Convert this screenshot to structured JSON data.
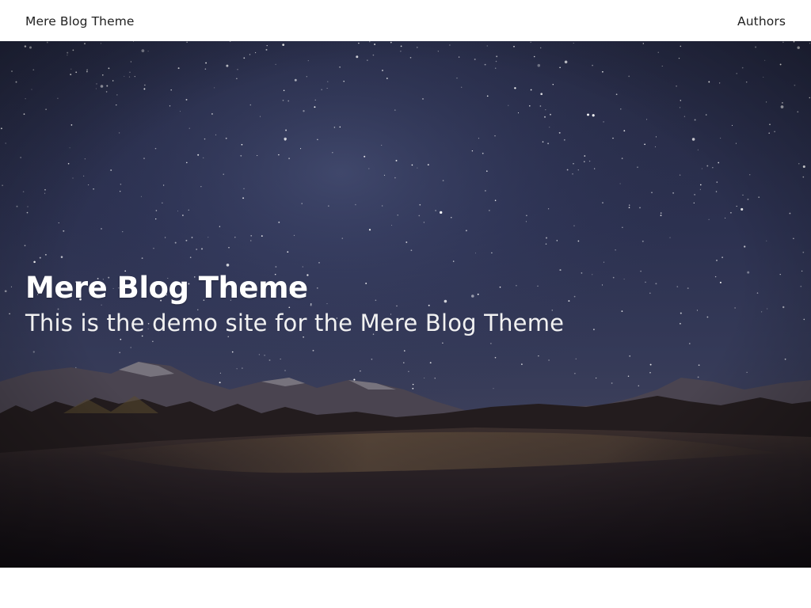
{
  "nav": {
    "site_title": "Mere Blog Theme",
    "authors_link": "Authors"
  },
  "hero": {
    "title": "Mere Blog Theme",
    "subtitle": "This is the demo site for the Mere Blog Theme",
    "image": "starry-night-mountains-photo"
  },
  "colors": {
    "nav_background": "#ffffff",
    "nav_text": "#222222",
    "hero_text": "#ffffff",
    "sky_top": "#2a2f4a",
    "ground": "#16121a"
  }
}
